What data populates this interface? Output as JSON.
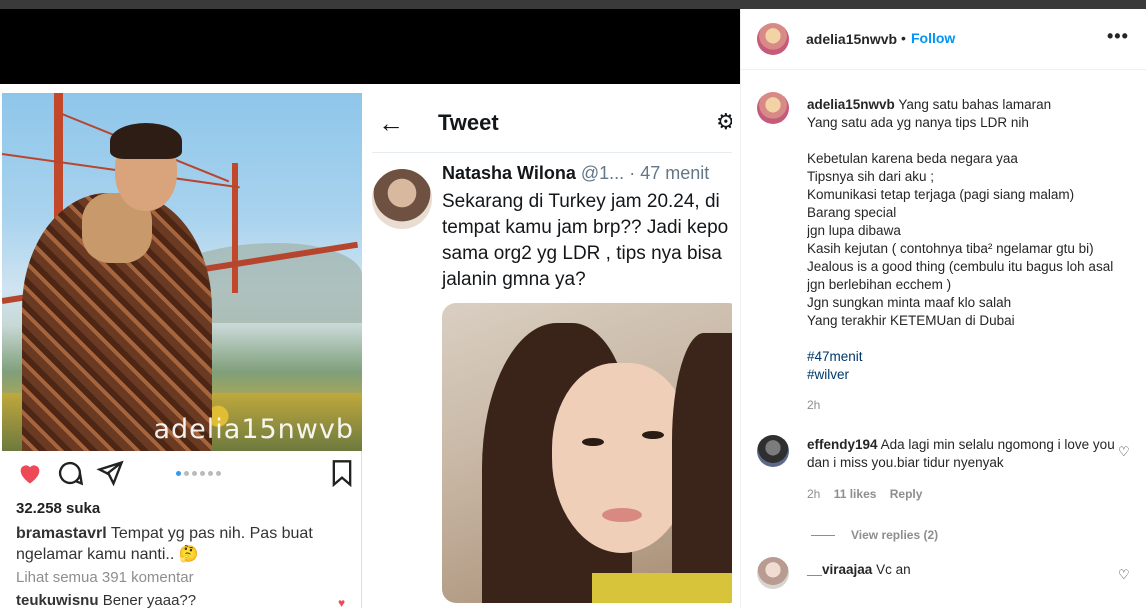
{
  "post_image": {
    "instagram": {
      "watermark": "adelia15nwvb",
      "likes": "32.258 suka",
      "caption_user": "bramastavrl",
      "caption_text": "Tempat yg pas nih. Pas buat ngelamar kamu nanti.. 🤔",
      "view_all": "Lihat semua 391 komentar",
      "comment_user": "teukuwisnu",
      "comment_text": "Bener yaaa??"
    },
    "tweet": {
      "header_title": "Tweet",
      "back_icon": "←",
      "gear_icon": "⚙",
      "author_name": "Natasha Wilona",
      "author_handle": "@1...",
      "time": "· 47 menit",
      "text": "Sekarang di Turkey jam 20.24, di tempat kamu jam brp?? Jadi kepo sama org2 yg LDR , tips nya bisa jalanin gmna ya?"
    }
  },
  "header": {
    "username": "adelia15nwvb",
    "dot": "•",
    "follow_label": "Follow",
    "more_icon": "•••"
  },
  "caption": {
    "username": "adelia15nwvb",
    "lines": [
      "Yang satu bahas lamaran",
      "Yang satu ada yg nanya tips LDR nih ",
      "",
      "Kebetulan karena beda negara yaa",
      "Tipsnya sih dari aku ;",
      "Komunikasi tetap terjaga (pagi siang malam) ",
      "Barang special",
      "jgn lupa dibawa",
      "Kasih kejutan ( contohnya tiba² ngelamar gtu bi)",
      "Jealous is a good thing (cembulu itu bagus loh asal",
      "jgn berlebihan ecchem )",
      "Jgn sungkan minta maaf klo salah ",
      "Yang terakhir KETEMUan di Dubai "
    ],
    "hashtags": [
      "#47menit",
      "#wilver"
    ],
    "time": "2h"
  },
  "comments": [
    {
      "username": "effendy194",
      "text": "Ada lagi min selalu ngomong i love you dan i miss you.biar tidur nyenyak",
      "time": "2h",
      "likes": "11 likes",
      "reply": "Reply",
      "view_replies": "View replies (2)"
    },
    {
      "username": "__viraajaa",
      "text": "Vc an"
    }
  ],
  "colors": {
    "follow": "#0095f6",
    "hashtag": "#00376b",
    "like_heart": "#ed4956"
  }
}
